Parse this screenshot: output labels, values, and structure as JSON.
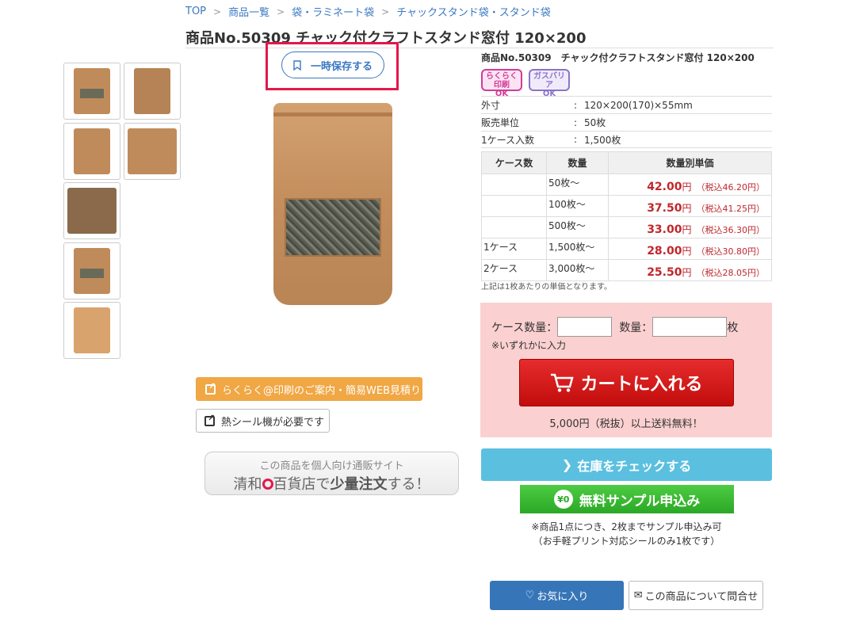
{
  "breadcrumb": [
    "TOP",
    "商品一覧",
    "袋・ラミネート袋",
    "チャックスタンド袋・スタンド袋"
  ],
  "page_title": "商品No.50309 チャック付クラフトスタンド窓付 120×200",
  "save_button": {
    "label": "一時保存する",
    "icon": "bookmark-icon"
  },
  "thumbnails": [
    "thumb-1",
    "thumb-2",
    "thumb-3",
    "thumb-4",
    "thumb-5",
    "thumb-6",
    "thumb-7"
  ],
  "links": {
    "rakuraku": "らくらく@印刷のご案内・簡易WEB見積り",
    "heat_seal": "熱シール機が必要です"
  },
  "banner": {
    "line1": "この商品を個人向け通販サイト",
    "line2_a": "清和",
    "line2_b": "百貨店で",
    "line2_c": "少量注文",
    "line2_d": "する！"
  },
  "product": {
    "title": "商品No.50309　チャック付クラフトスタンド窓付 120×200",
    "badges": [
      {
        "line1": "らくらく印刷",
        "line2": "OK",
        "color": "#d33b9a"
      },
      {
        "line1": "ガスバリア",
        "line2": "OK",
        "color": "#8c74c7"
      }
    ],
    "specs": [
      {
        "key": "外寸",
        "value": "120×200(170)×55mm"
      },
      {
        "key": "販売単位",
        "value": "50枚"
      },
      {
        "key": "1ケース入数",
        "value": "1,500枚"
      }
    ]
  },
  "price_table": {
    "headers": [
      "ケース数",
      "数量",
      "数量別単価"
    ],
    "rows": [
      {
        "cases": "",
        "qty": "50枚～",
        "price": "42.00",
        "unit": "円",
        "tax": "（税込46.20円）"
      },
      {
        "cases": "",
        "qty": "100枚～",
        "price": "37.50",
        "unit": "円",
        "tax": "（税込41.25円）"
      },
      {
        "cases": "",
        "qty": "500枚～",
        "price": "33.00",
        "unit": "円",
        "tax": "（税込36.30円）"
      },
      {
        "cases": "1ケース",
        "qty": "1,500枚～",
        "price": "28.00",
        "unit": "円",
        "tax": "（税込30.80円）"
      },
      {
        "cases": "2ケース",
        "qty": "3,000枚～",
        "price": "25.50",
        "unit": "円",
        "tax": "（税込28.05円）"
      }
    ],
    "note": "上記は1枚あたりの単価となります。"
  },
  "cart": {
    "case_label": "ケース数量：",
    "qty_label": "数量：",
    "qty_unit": "枚",
    "case_value": "",
    "qty_value": "",
    "note": "※いずれかに入力",
    "button": "カートに入れる",
    "free_shipping": "5,000円（税抜）以上送料無料！"
  },
  "stock_button": "在庫をチェックする",
  "sample_button": {
    "label": "無料サンプル申込み",
    "icon_text": "¥0"
  },
  "sample_note": [
    "※商品1点につき、2枚までサンプル申込み可",
    "（お手軽プリント対応シールのみ1枚です）"
  ],
  "favorite_button": "お気に入り",
  "inquiry_button": "この商品について問合せ",
  "colors": {
    "accent_blue": "#3676b8",
    "price_red": "#c0272d",
    "cart_red": "#c20d0d",
    "highlight": "#e4174b"
  }
}
